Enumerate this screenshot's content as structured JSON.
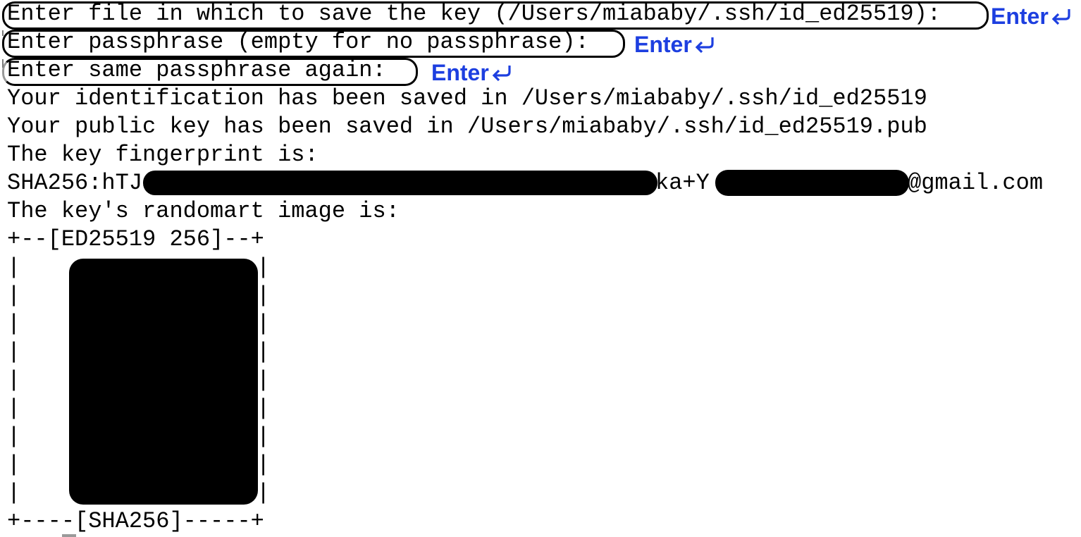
{
  "terminal": {
    "prompts": [
      {
        "text": "Enter file in which to save the key (/Users/miababy/.ssh/id_ed25519):",
        "annotation": "Enter"
      },
      {
        "text": "Enter passphrase (empty for no passphrase):",
        "annotation": "Enter"
      },
      {
        "text": "Enter same passphrase again:",
        "annotation": "Enter"
      }
    ],
    "output": {
      "identification_saved": "Your identification has been saved in /Users/miababy/.ssh/id_ed25519",
      "public_key_saved": "Your public key has been saved in /Users/miababy/.ssh/id_ed25519.pub",
      "fingerprint_label": "The key fingerprint is:",
      "fingerprint_prefix": "SHA256:hTJ",
      "fingerprint_mid": "ka+Y",
      "fingerprint_email_suffix": "@gmail.com",
      "randomart_label": "The key's randomart image is:",
      "randomart_top": "+--[ED25519 256]--+",
      "randomart_side": "|",
      "randomart_bottom": "+----[SHA256]-----+"
    }
  },
  "colors": {
    "annotation": "#1d3fe0",
    "text": "#000000",
    "redaction": "#000000"
  },
  "icons": {
    "return_arrow": "return-arrow-icon"
  }
}
